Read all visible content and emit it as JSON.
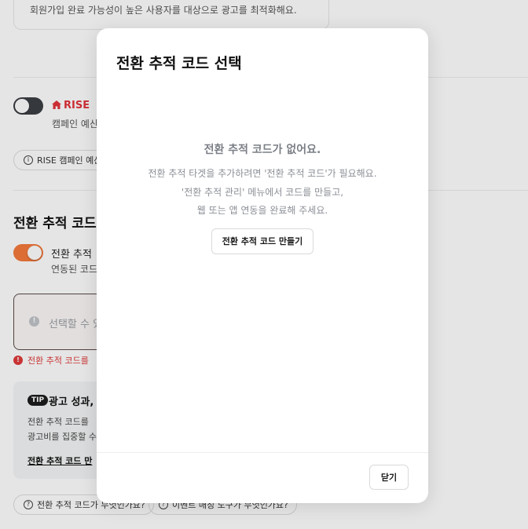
{
  "background": {
    "top_description": "회원가입 완료 가능성이 높은 사용자를 대상으로 광고를 최적화해요.",
    "rise": {
      "logo_text": "RISE",
      "subtext": "캠페인 예산",
      "chip_label": "RISE 캠페인 예산"
    },
    "conversion_section": {
      "title": "전환 추적 코드",
      "toggle_label": "전환 추적",
      "toggle_sub": "연동된 코드",
      "input_placeholder": "선택할 수 있",
      "error_text": "전환 추적 코드를"
    },
    "tip": {
      "badge": "TIP",
      "title": "광고 성과,",
      "line1": "전환 추적 코드를",
      "line2": "광고비를 집중할 수",
      "link": "전환 추적 코드 만"
    },
    "bottom_chips": [
      "전환 추적 코드가 무엇인가요?",
      "이벤트 매칭 도구가 무엇인가요?"
    ]
  },
  "modal": {
    "title": "전환 추적 코드 선택",
    "empty_title": "전환 추적 코드가 없어요.",
    "empty_lines": [
      "전환 추적 타겟을 추가하려면 '전환 추적 코드'가 필요해요.",
      "'전환 추적 관리' 메뉴에서 코드를 만들고,",
      "웹 또는 앱 연동을 완료해 주세요."
    ],
    "create_button": "전환 추적 코드 만들기",
    "close_button": "닫기"
  }
}
